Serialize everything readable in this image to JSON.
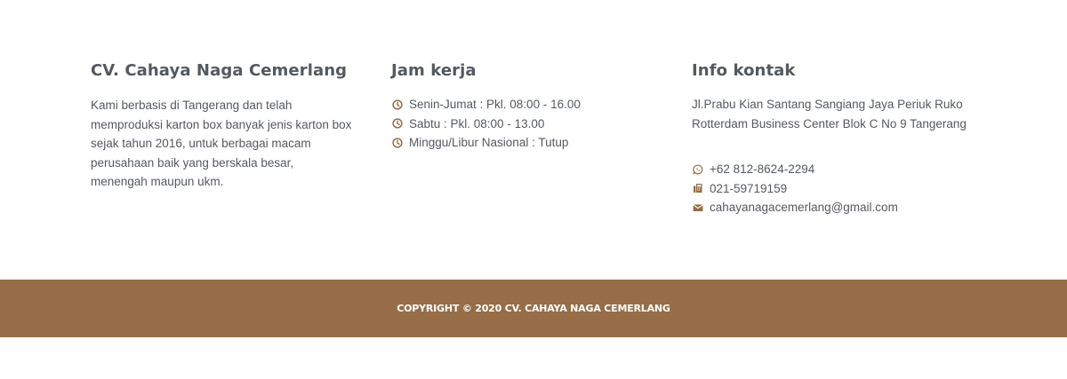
{
  "about": {
    "title": "CV. Cahaya Naga Cemerlang",
    "description": "Kami berbasis di Tangerang dan telah memproduksi karton box banyak jenis karton box sejak tahun 2016, untuk berbagai macam perusahaan baik yang berskala besar, menengah maupun ukm."
  },
  "hours": {
    "title": "Jam kerja",
    "items": [
      {
        "icon": "clock-icon",
        "label": "Senin-Jumat : Pkl. 08:00 - 16.00"
      },
      {
        "icon": "clock-icon",
        "label": "Sabtu : Pkl. 08:00 - 13.00"
      },
      {
        "icon": "clock-icon",
        "label": "Minggu/Libur Nasional : Tutup"
      }
    ]
  },
  "contact": {
    "title": "Info kontak",
    "address": "Jl.Prabu Kian Santang Sangiang Jaya Periuk Ruko Rotterdam Business Center Blok C No 9 Tangerang",
    "items": [
      {
        "icon": "whatsapp-icon",
        "label": "+62 812-8624-2294"
      },
      {
        "icon": "fax-icon",
        "label": "021-59719159"
      },
      {
        "icon": "envelope-icon",
        "label": "cahayanagacemerlang@gmail.com"
      }
    ]
  },
  "footer": {
    "copyright": "Copyright © 2020 CV. Cahaya Naga Cemerlang"
  },
  "colors": {
    "accent": "#966d47",
    "text": "#54595f",
    "background": "#ffffff"
  }
}
